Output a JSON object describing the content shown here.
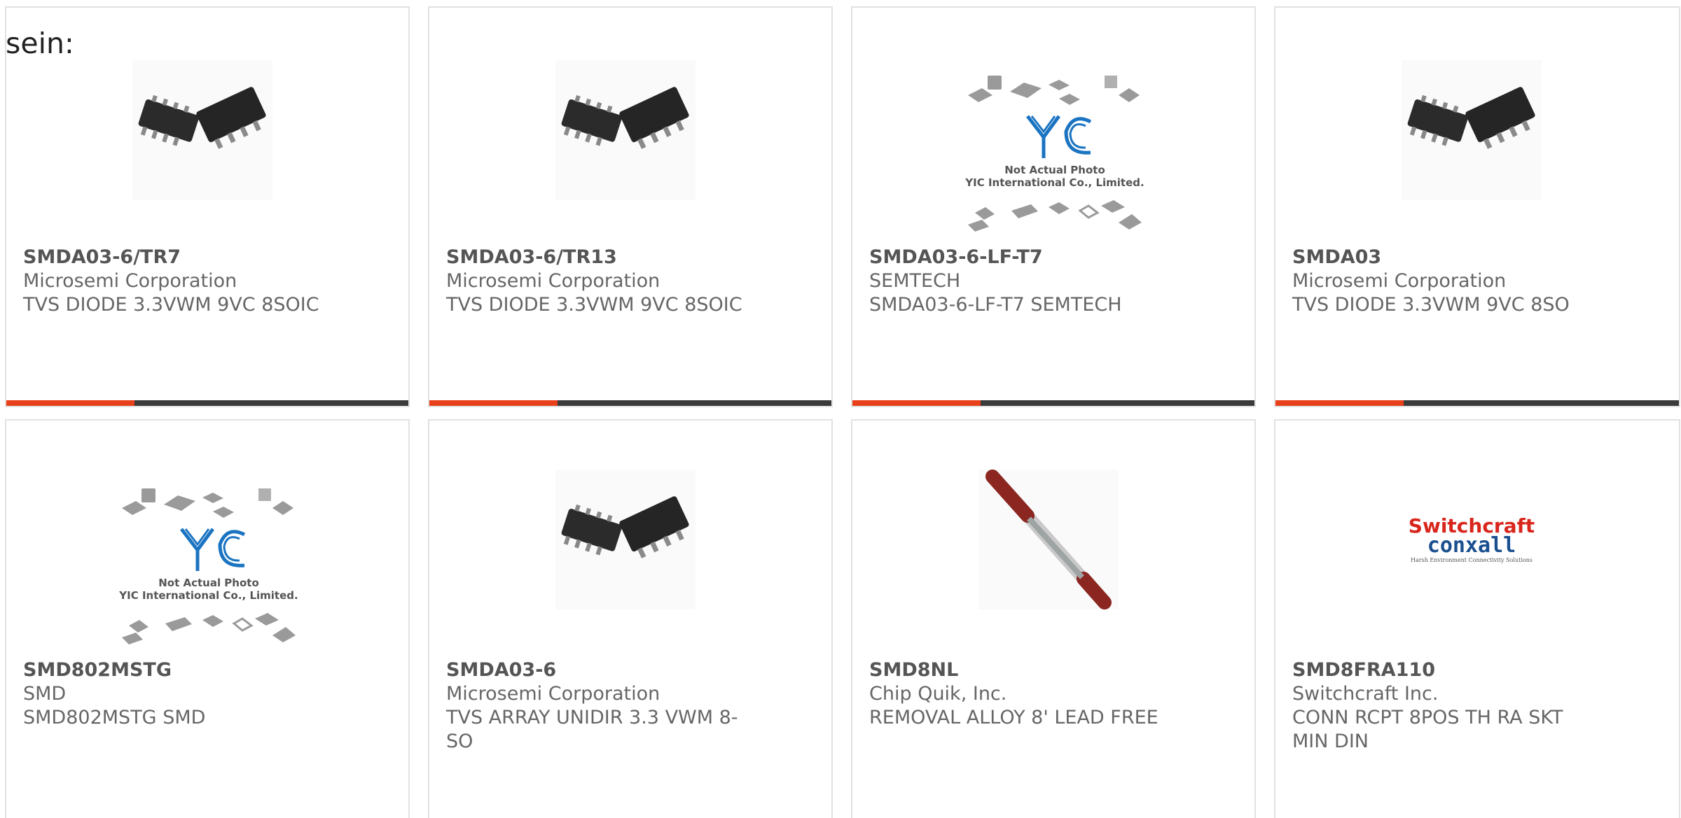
{
  "intro_text": "sein:",
  "colors": {
    "accent": "#e8401b",
    "bar": "#3b3b3b",
    "border": "#e1e1e1"
  },
  "products": [
    {
      "part_number": "SMDA03-6/TR7",
      "manufacturer": "Microsemi Corporation",
      "description": "TVS DIODE 3.3VWM 9VC 8SOIC",
      "image": "soic-chip"
    },
    {
      "part_number": "SMDA03-6/TR13",
      "manufacturer": "Microsemi Corporation",
      "description": "TVS DIODE 3.3VWM 9VC 8SOIC",
      "image": "soic-chip"
    },
    {
      "part_number": "SMDA03-6-LF-T7",
      "manufacturer": "SEMTECH",
      "description": "SMDA03-6-LF-T7 SEMTECH",
      "image": "yic-placeholder",
      "placeholder_line1": "Not Actual Photo",
      "placeholder_line2": "YIC International Co., Limited."
    },
    {
      "part_number": "SMDA03",
      "manufacturer": "Microsemi Corporation",
      "description": "TVS DIODE 3.3VWM 9VC 8SO",
      "image": "soic-chip"
    },
    {
      "part_number": "SMD802MSTG",
      "manufacturer": "SMD",
      "description": "SMD802MSTG SMD",
      "image": "yic-placeholder",
      "placeholder_line1": "Not Actual Photo",
      "placeholder_line2": "YIC International Co., Limited."
    },
    {
      "part_number": "SMDA03-6",
      "manufacturer": "Microsemi Corporation",
      "description": "TVS ARRAY UNIDIR 3.3 VWM 8-SO",
      "image": "soic-chip"
    },
    {
      "part_number": "SMD8NL",
      "manufacturer": "Chip Quik, Inc.",
      "description": "REMOVAL ALLOY 8' LEAD FREE",
      "image": "alloy-rod"
    },
    {
      "part_number": "SMD8FRA110",
      "manufacturer": "Switchcraft Inc.",
      "description": "CONN RCPT 8POS TH RA SKT MIN DIN",
      "image": "switchcraft-logo",
      "logo_line1": "Switchcraft",
      "logo_line2": "conxall",
      "logo_tagline": "Harsh Environment Connectivity Solutions"
    }
  ]
}
